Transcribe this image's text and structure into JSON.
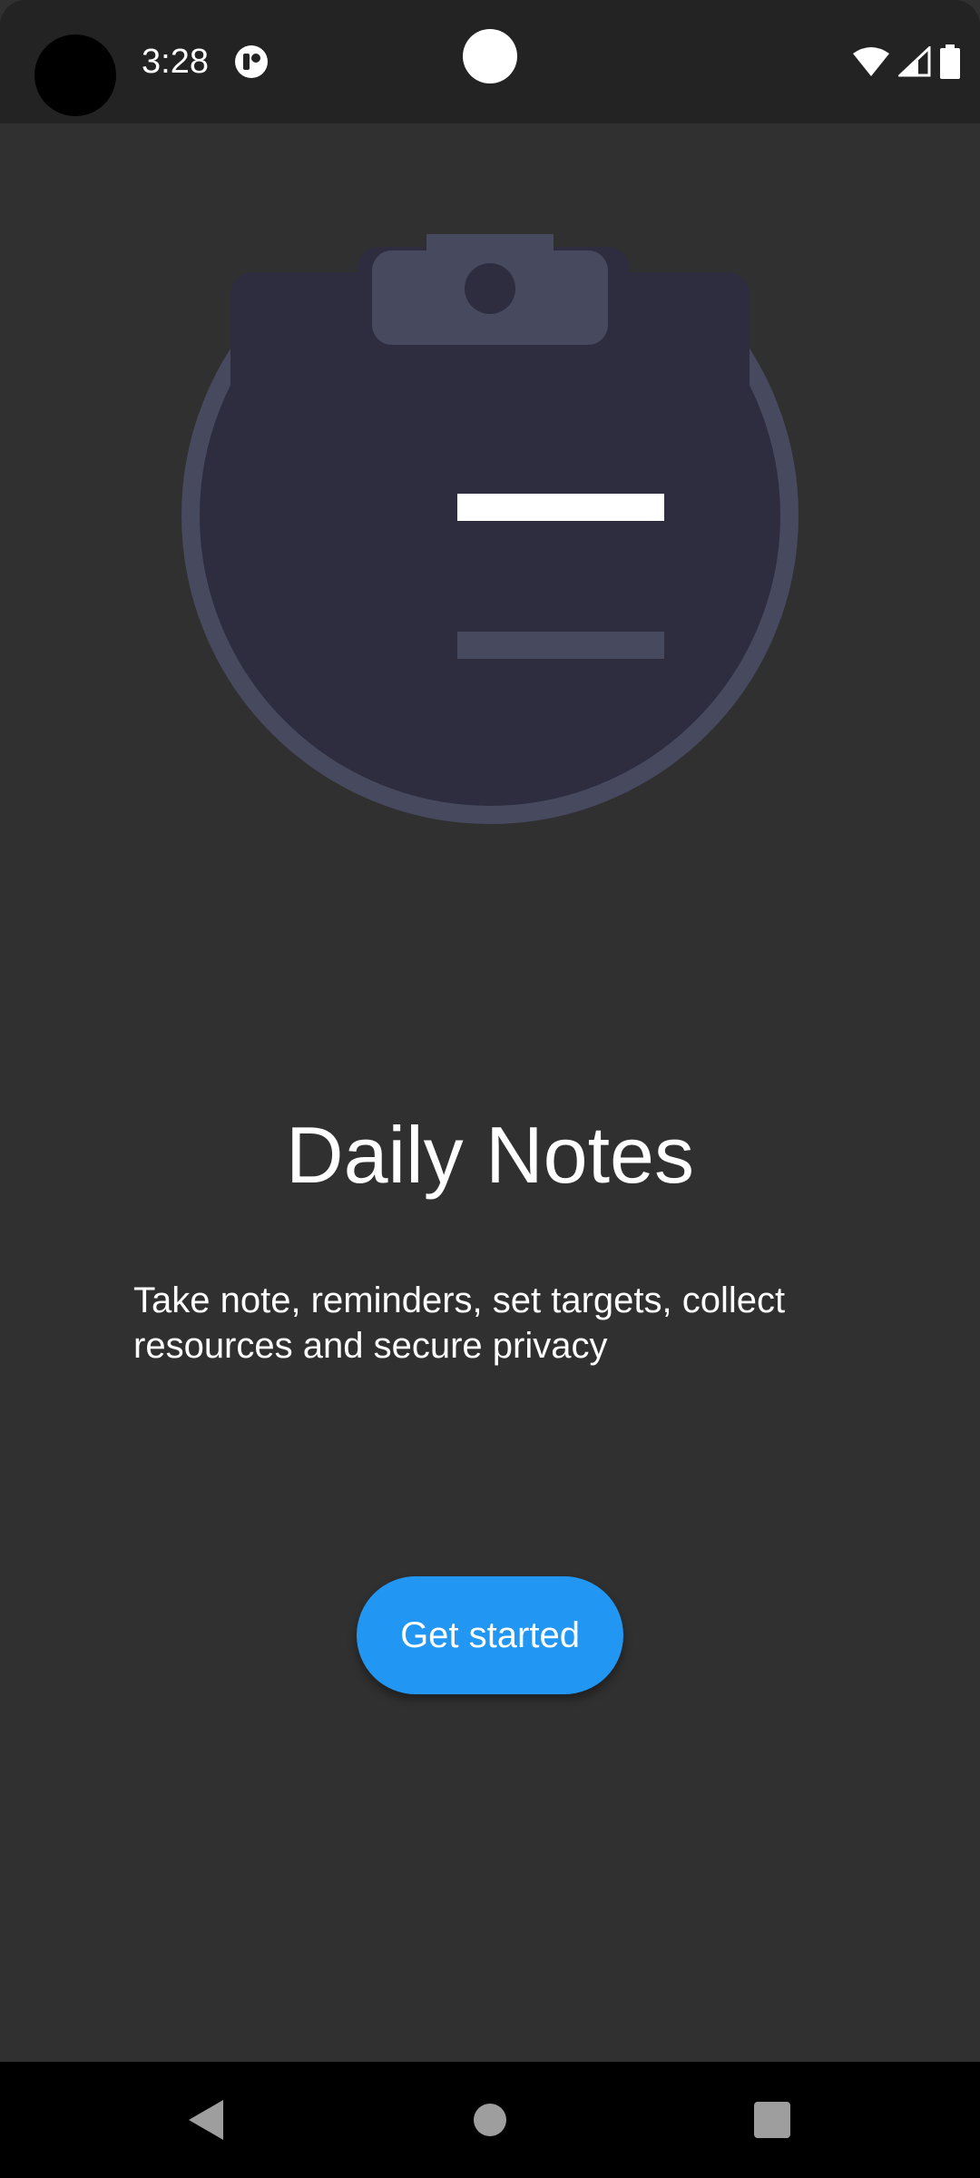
{
  "status_bar": {
    "time": "3:28",
    "icons": [
      "app-notification-icon",
      "wifi-icon",
      "cell-signal-icon",
      "battery-icon"
    ]
  },
  "onboarding": {
    "illustration": "clipboard-notes-icon",
    "title": "Daily Notes",
    "description": "Take note, reminders, set targets, collect resources and secure privacy",
    "primary_button": "Get started"
  },
  "nav_bar": {
    "buttons": [
      "back-icon",
      "home-icon",
      "recents-icon"
    ]
  },
  "colors": {
    "background": "#303030",
    "status_bar": "#232323",
    "accent": "#2196f3",
    "illustration_dark": "#2e2d40",
    "illustration_light": "#474a5f"
  }
}
